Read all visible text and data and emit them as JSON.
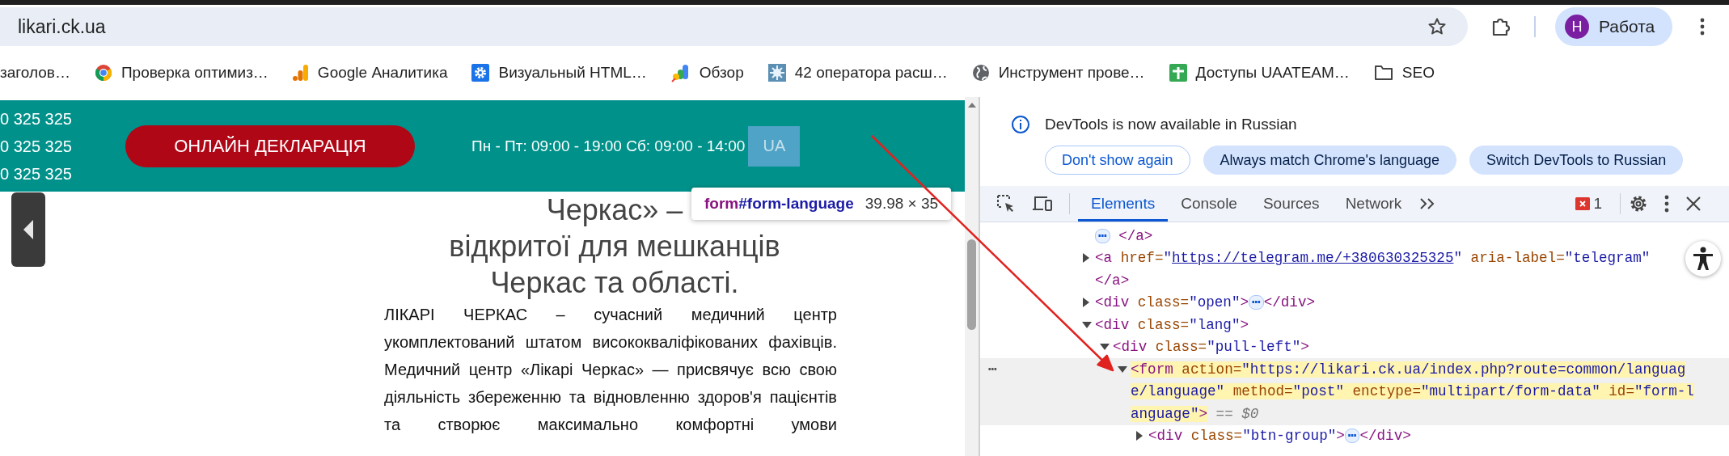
{
  "browser": {
    "url": "likari.ck.ua",
    "profile": {
      "initial": "Н",
      "name": "Работа"
    },
    "bookmarks": [
      {
        "label": "заголов…",
        "kind": "plain"
      },
      {
        "label": "Проверка оптимиз…",
        "kind": "chrome"
      },
      {
        "label": "Google Аналитика",
        "kind": "analytics"
      },
      {
        "label": "Визуальный HTML…",
        "kind": "gear"
      },
      {
        "label": "Обзор",
        "kind": "looker"
      },
      {
        "label": "42 оператора расш…",
        "kind": "splat"
      },
      {
        "label": "Инструмент прове…",
        "kind": "globe"
      },
      {
        "label": "Доступы UAATEAM…",
        "kind": "sheet"
      },
      {
        "label": "SEO",
        "kind": "folder"
      }
    ]
  },
  "site": {
    "phones": [
      "0 325 325",
      "0 325 325",
      "0 325 325"
    ],
    "declaration_button": "ОНЛАЙН ДЕКЛАРАЦІЯ",
    "hours": "Пн - Пт: 09:00 - 19:00 Сб: 09:00 - 14:00",
    "language": {
      "label": "UA",
      "inspected": true
    },
    "tooltip": {
      "tag": "form",
      "id": "#form-language",
      "size": "39.98 × 35"
    },
    "heading_lines": [
      "Черкас» –",
      "відкритої для мешканців",
      "Черкас та області."
    ],
    "paragraphs": [
      "ЛІКАРІ ЧЕРКАС – сучасний медичний центр укомплектований штатом висококваліфікованих фахівців.",
      "Медичний центр «Лікарі Черкас» — присвячує всю свою діяльність збереженню та відновленню здоров'я пацієнтів та створює максимально комфортні умови"
    ]
  },
  "devtools": {
    "notice": {
      "text": "DevTools is now available in Russian",
      "buttons": [
        {
          "label": "Don't show again",
          "kind": "outline"
        },
        {
          "label": "Always match Chrome's language",
          "kind": "filled"
        },
        {
          "label": "Switch DevTools to Russian",
          "kind": "filled"
        }
      ]
    },
    "tabs": [
      {
        "label": "Elements",
        "selected": true
      },
      {
        "label": "Console",
        "selected": false
      },
      {
        "label": "Sources",
        "selected": false
      },
      {
        "label": "Network",
        "selected": false
      }
    ],
    "error_count": "1",
    "tree": [
      {
        "selected": false,
        "lines": [
          [
            {
              "kind": "ellipsis",
              "text": "⋯"
            },
            {
              "kind": "tag",
              "text": " </a>"
            }
          ]
        ]
      },
      {
        "expanded": false,
        "selected": false,
        "lines": [
          [
            {
              "kind": "tag",
              "text": "<a"
            },
            {
              "kind": "attr",
              "text": " href="
            },
            {
              "kind": "value",
              "text": "\""
            },
            {
              "kind": "link",
              "text": "https://telegram.me/+380630325325"
            },
            {
              "kind": "value",
              "text": "\""
            },
            {
              "kind": "attr",
              "text": " aria-label="
            },
            {
              "kind": "value",
              "text": "\"telegram\""
            }
          ],
          [
            {
              "kind": "tag",
              "text": "</a>"
            }
          ]
        ]
      },
      {
        "expanded": false,
        "selected": false,
        "lines": [
          [
            {
              "kind": "tag",
              "text": "<div"
            },
            {
              "kind": "attr",
              "text": " class="
            },
            {
              "kind": "value",
              "text": "\"open\""
            },
            {
              "kind": "tag",
              "text": ">"
            },
            {
              "kind": "ellipsis",
              "text": "⋯"
            },
            {
              "kind": "tag",
              "text": "</div>"
            }
          ]
        ]
      },
      {
        "expanded": true,
        "selected": false,
        "lines": [
          [
            {
              "kind": "tag",
              "text": "<div"
            },
            {
              "kind": "attr",
              "text": " class="
            },
            {
              "kind": "value",
              "text": "\"lang\""
            },
            {
              "kind": "tag",
              "text": ">"
            }
          ]
        ],
        "children": [
          {
            "expanded": true,
            "selected": false,
            "lines": [
              [
                {
                  "kind": "tag",
                  "text": "<div"
                },
                {
                  "kind": "attr",
                  "text": " class="
                },
                {
                  "kind": "value",
                  "text": "\"pull-left\""
                },
                {
                  "kind": "tag",
                  "text": ">"
                }
              ]
            ],
            "children": [
              {
                "expanded": true,
                "selected": true,
                "gutter": "⋯",
                "lines": [
                  [
                    {
                      "kind": "tag",
                      "text": "<form"
                    },
                    {
                      "kind": "attr",
                      "text": " action="
                    },
                    {
                      "kind": "value",
                      "text": "\"https://likari.ck.ua/index.php?route=common/languag"
                    }
                  ],
                  [
                    {
                      "kind": "value",
                      "text": "e/language\""
                    },
                    {
                      "kind": "attr",
                      "text": " method="
                    },
                    {
                      "kind": "value",
                      "text": "\"post\""
                    },
                    {
                      "kind": "attr",
                      "text": " enctype="
                    },
                    {
                      "kind": "value",
                      "text": "\"multipart/form-data\""
                    },
                    {
                      "kind": "attr",
                      "text": " id="
                    },
                    {
                      "kind": "value",
                      "text": "\"form-l"
                    }
                  ],
                  [
                    {
                      "kind": "value",
                      "text": "anguage\""
                    },
                    {
                      "kind": "tag",
                      "text": ">"
                    },
                    {
                      "kind": "marker",
                      "text": " == $0"
                    }
                  ]
                ],
                "children": [
                  {
                    "expanded": false,
                    "selected": false,
                    "lines": [
                      [
                        {
                          "kind": "tag",
                          "text": "<div"
                        },
                        {
                          "kind": "attr",
                          "text": " class="
                        },
                        {
                          "kind": "value",
                          "text": "\"btn-group\""
                        },
                        {
                          "kind": "tag",
                          "text": ">"
                        },
                        {
                          "kind": "ellipsis",
                          "text": "⋯"
                        },
                        {
                          "kind": "tag",
                          "text": "</div>"
                        }
                      ]
                    ]
                  }
                ]
              }
            ]
          }
        ]
      }
    ]
  }
}
